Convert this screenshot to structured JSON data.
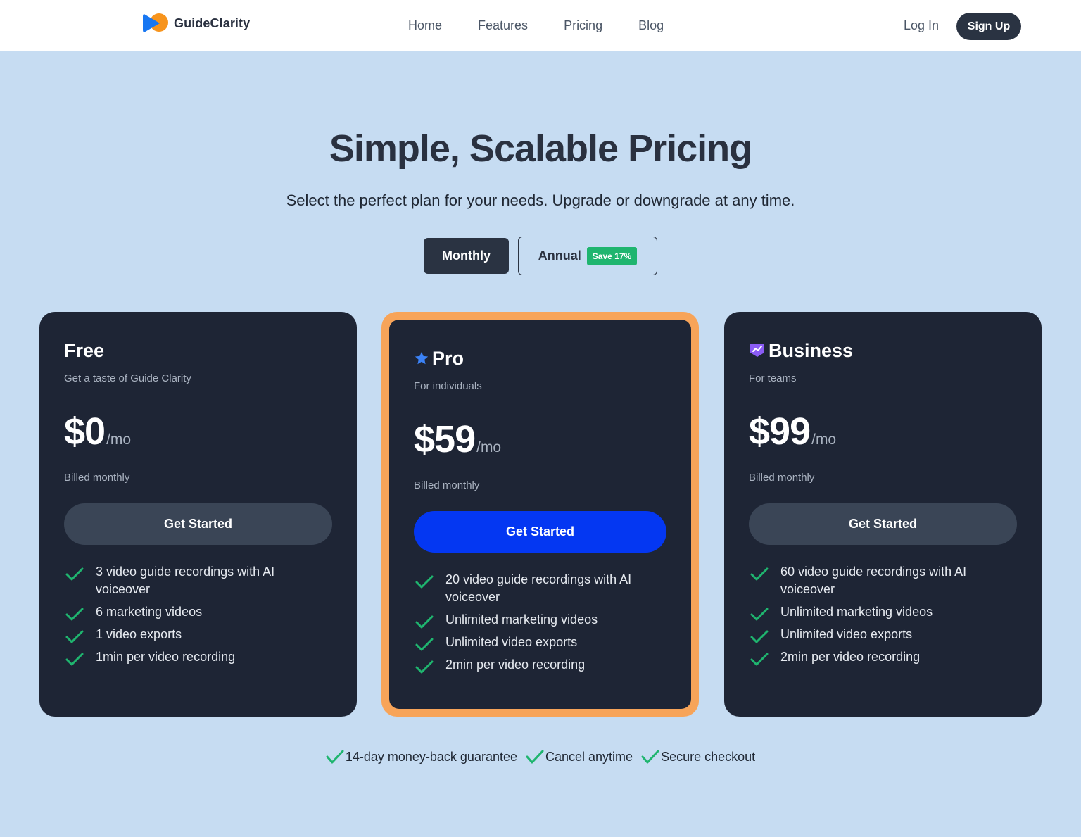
{
  "header": {
    "brand": "GuideClarity",
    "nav": [
      "Home",
      "Features",
      "Pricing",
      "Blog"
    ],
    "login": "Log In",
    "signup": "Sign Up"
  },
  "hero": {
    "title": "Simple, Scalable Pricing",
    "subtitle": "Select the perfect plan for your needs. Upgrade or downgrade at any time.",
    "toggle": {
      "monthly": "Monthly",
      "annual": "Annual",
      "save_badge": "Save 17%",
      "selected": "Monthly"
    }
  },
  "plans": [
    {
      "name": "Free",
      "description": "Get a taste of Guide Clarity",
      "price": "$0",
      "per": "/mo",
      "billed": "Billed monthly",
      "cta": "Get Started",
      "features": [
        "3 video guide recordings with AI voiceover",
        "6 marketing videos",
        "1 video exports",
        "1min per video recording"
      ]
    },
    {
      "name": "Pro",
      "icon": "star-icon",
      "description": "For individuals",
      "price": "$59",
      "per": "/mo",
      "billed": "Billed monthly",
      "cta": "Get Started",
      "features": [
        "20 video guide recordings with AI voiceover",
        "Unlimited marketing videos",
        "Unlimited video exports",
        "2min per video recording"
      ]
    },
    {
      "name": "Business",
      "icon": "chart-badge-icon",
      "description": "For teams",
      "price": "$99",
      "per": "/mo",
      "billed": "Billed monthly",
      "cta": "Get Started",
      "features": [
        "60 video guide recordings with AI voiceover",
        "Unlimited marketing videos",
        "Unlimited video exports",
        "2min per video recording"
      ]
    }
  ],
  "guarantees": [
    "14-day money-back guarantee",
    "Cancel anytime",
    "Secure checkout"
  ],
  "colors": {
    "background": "#c6dcf2",
    "card": "#1e2535",
    "accent_blue": "#0437f2",
    "pro_border": "#f7a459",
    "check_green": "#1fb56f",
    "dark_button": "#2a3342"
  }
}
